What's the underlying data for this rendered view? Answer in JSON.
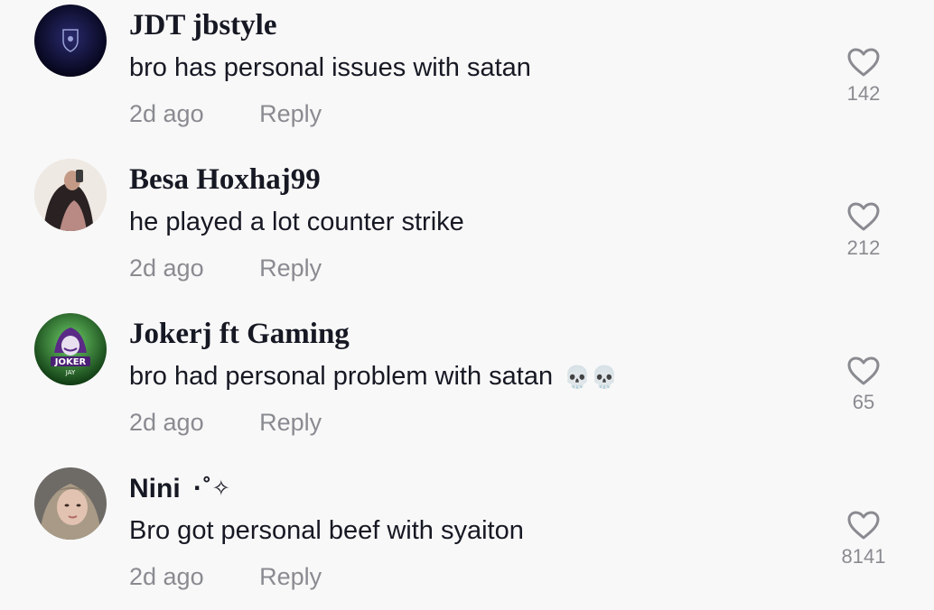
{
  "comments": [
    {
      "username": "JDT jbstyle",
      "text": "bro has personal issues with satan",
      "emoji": "",
      "time": "2d ago",
      "reply_label": "Reply",
      "likes": "142",
      "avatar": "club-crest-avatar"
    },
    {
      "username": "Besa Hoxhaj99",
      "text": "he played a lot counter strike",
      "emoji": "",
      "time": "2d ago",
      "reply_label": "Reply",
      "likes": "212",
      "avatar": "mirror-selfie-avatar"
    },
    {
      "username": "Jokerj ft Gaming",
      "text": "bro had personal problem with satan",
      "emoji": "💀💀",
      "time": "2d ago",
      "reply_label": "Reply",
      "likes": "65",
      "avatar": "joker-gaming-logo-avatar"
    },
    {
      "username": "Nini",
      "username_decoration": "⋅˚✧",
      "text": "Bro got personal beef with syaiton",
      "emoji": "",
      "time": "2d ago",
      "reply_label": "Reply",
      "likes": "8141",
      "avatar": "hijab-selfie-avatar"
    }
  ],
  "icons": {
    "like": "heart-outline-icon"
  },
  "colors": {
    "text_primary": "#161823",
    "text_secondary": "#8a8b91",
    "background": "#f8f8f8"
  }
}
